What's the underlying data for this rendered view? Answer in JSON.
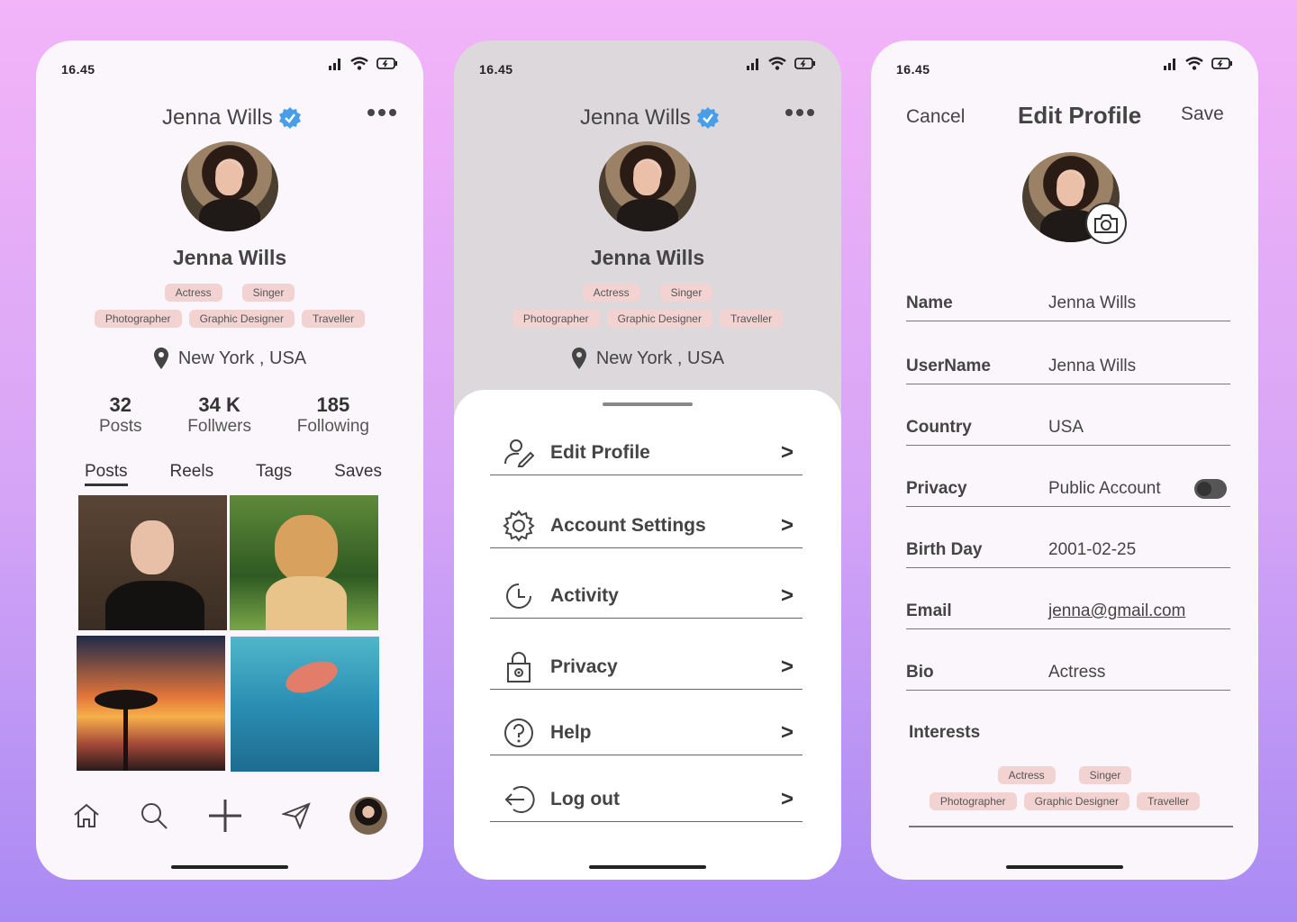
{
  "status": {
    "time": "16.45"
  },
  "profile": {
    "header_name": "Jenna Wills",
    "full_name": "Jenna Wills",
    "tags_row1": [
      "Actress",
      "Singer"
    ],
    "tags_row2": [
      "Photographer",
      "Graphic Designer",
      "Traveller"
    ],
    "location": "New York , USA",
    "stats": [
      {
        "value": "32",
        "label": "Posts"
      },
      {
        "value": "34 K",
        "label": "Follwers"
      },
      {
        "value": "185",
        "label": "Following"
      }
    ],
    "tabs": [
      "Posts",
      "Reels",
      "Tags",
      "Saves"
    ],
    "active_tab": "Posts"
  },
  "menu": {
    "items": [
      {
        "label": "Edit Profile",
        "icon": "user-edit-icon"
      },
      {
        "label": "Account Settings",
        "icon": "gear-icon"
      },
      {
        "label": "Activity",
        "icon": "clock-icon"
      },
      {
        "label": "Privacy",
        "icon": "lock-icon"
      },
      {
        "label": "Help",
        "icon": "question-icon"
      },
      {
        "label": "Log out",
        "icon": "logout-icon"
      }
    ],
    "chevron": ">"
  },
  "edit": {
    "cancel": "Cancel",
    "title": "Edit Profile",
    "save": "Save",
    "fields": [
      {
        "label": "Name",
        "value": "Jenna Wills"
      },
      {
        "label": "UserName",
        "value": "Jenna Wills"
      },
      {
        "label": "Country",
        "value": "USA"
      },
      {
        "label": "Privacy",
        "value": "Public Account"
      },
      {
        "label": "Birth Day",
        "value": "2001-02-25"
      },
      {
        "label": "Email",
        "value": "jenna@gmail.com"
      },
      {
        "label": "Bio",
        "value": "Actress"
      }
    ],
    "interests_label": "Interests",
    "interests_row1": [
      "Actress",
      "Singer"
    ],
    "interests_row2": [
      "Photographer",
      "Graphic Designer",
      "Traveller"
    ]
  },
  "colors": {
    "verified": "#4a9ee8",
    "tag_bg": "#f3d2d2"
  }
}
